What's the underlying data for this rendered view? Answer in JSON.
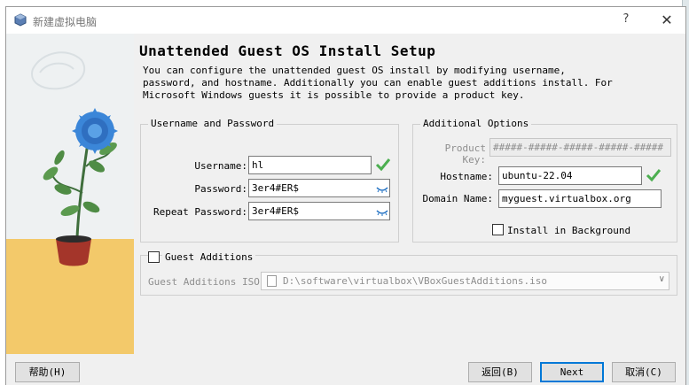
{
  "window": {
    "title": "新建虚拟电脑",
    "help": "?",
    "close": "✕"
  },
  "page": {
    "heading": "Unattended Guest OS Install Setup",
    "intro": "You can configure the unattended guest OS install by modifying username, password, and hostname. Additionally you can enable guest additions install. For Microsoft Windows guests it is possible to provide a product key."
  },
  "user_group": {
    "title": "Username and Password",
    "username_label": "Username:",
    "username_value": "hl",
    "password_label": "Password:",
    "password_value": "3er4#ER$",
    "repeat_label": "Repeat Password:",
    "repeat_value": "3er4#ER$"
  },
  "options_group": {
    "title": "Additional Options",
    "product_key_label": "Product Key:",
    "product_key_value": "#####-#####-#####-#####-#####",
    "hostname_label": "Hostname:",
    "hostname_value": "ubuntu-22.04",
    "domain_label": "Domain Name:",
    "domain_value": "myguest.virtualbox.org",
    "install_bg_label": "Install in Background",
    "install_bg_checked": false
  },
  "guest_additions": {
    "title": "Guest Additions",
    "checked": false,
    "iso_label": "Guest Additions ISO:",
    "iso_value": "D:\\software\\virtualbox\\VBoxGuestAdditions.iso"
  },
  "footer": {
    "help": "帮助(H)",
    "back": "返回(B)",
    "next": "Next",
    "cancel": "取消(C)"
  },
  "colors": {
    "valid_check": "#4caf50",
    "eye_icon": "#1e6fc2",
    "flower": "#3b86d8",
    "ground": "#f3c96a",
    "pot": "#a4352a"
  }
}
